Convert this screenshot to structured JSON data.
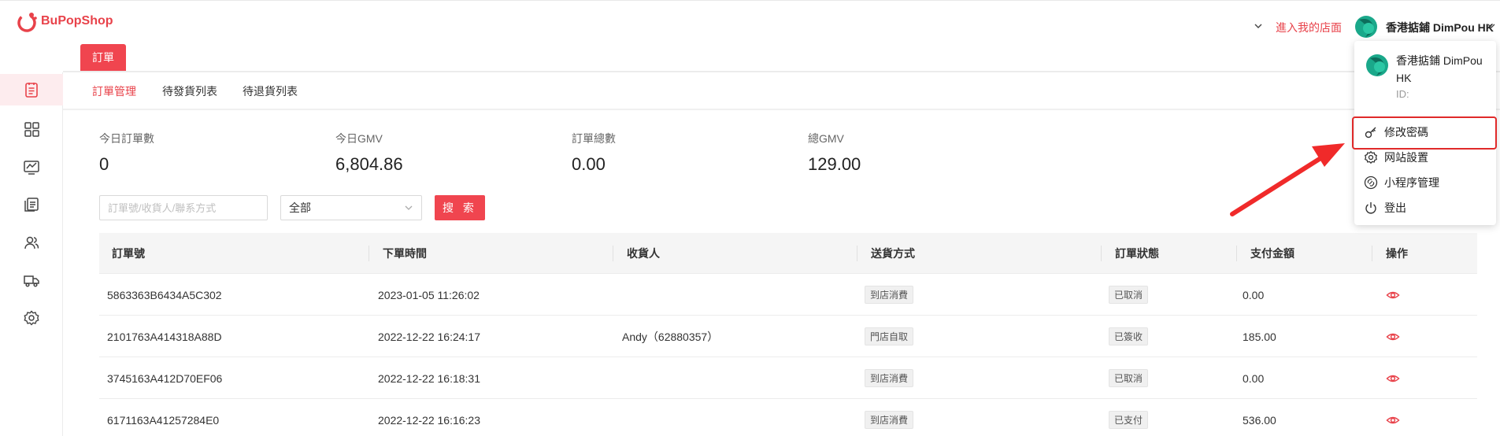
{
  "header": {
    "logo_text": "BuPopShop",
    "enter_store": "進入我的店面",
    "username": "香港掂鋪 DimPou HK",
    "accent_color": "#e8424a"
  },
  "top_tab": {
    "label": "訂單"
  },
  "sidebar": {
    "items": [
      {
        "icon": "order-list-icon",
        "active": true
      },
      {
        "icon": "grid-apps-icon",
        "active": false
      },
      {
        "icon": "chart-monitor-icon",
        "active": false
      },
      {
        "icon": "documents-icon",
        "active": false
      },
      {
        "icon": "users-icon",
        "active": false
      },
      {
        "icon": "delivery-truck-icon",
        "active": false
      },
      {
        "icon": "gear-icon",
        "active": false
      }
    ]
  },
  "subtabs": [
    {
      "label": "訂單管理",
      "active": true
    },
    {
      "label": "待發貨列表",
      "active": false
    },
    {
      "label": "待退貨列表",
      "active": false
    }
  ],
  "stats": [
    {
      "label": "今日訂單數",
      "value": "0"
    },
    {
      "label": "今日GMV",
      "value": "6,804.86"
    },
    {
      "label": "訂單總數",
      "value": "0.00"
    },
    {
      "label": "總GMV",
      "value": "129.00"
    }
  ],
  "filters": {
    "search_placeholder": "訂單號/收貨人/聯系方式",
    "select_value": "全部",
    "search_button": "搜 索"
  },
  "table": {
    "columns": [
      "訂單號",
      "下單時間",
      "收貨人",
      "送貨方式",
      "訂單狀態",
      "支付金額",
      "操作"
    ],
    "rows": [
      {
        "order_no": "5863363B6434A5C302",
        "time": "2023-01-05 11:26:02",
        "receiver": "",
        "delivery": "到店消費",
        "status": "已取消",
        "amount": "0.00"
      },
      {
        "order_no": "2101763A414318A88D",
        "time": "2022-12-22 16:24:17",
        "receiver": "Andy（62880357）",
        "delivery": "門店自取",
        "status": "已簽收",
        "amount": "185.00"
      },
      {
        "order_no": "3745163A412D70EF06",
        "time": "2022-12-22 16:18:31",
        "receiver": "",
        "delivery": "到店消費",
        "status": "已取消",
        "amount": "0.00"
      },
      {
        "order_no": "6171163A41257284E0",
        "time": "2022-12-22 16:16:23",
        "receiver": "",
        "delivery": "到店消費",
        "status": "已支付",
        "amount": "536.00"
      }
    ]
  },
  "dropdown": {
    "name": "香港掂鋪 DimPou HK",
    "id_label": "ID:",
    "items": [
      {
        "label": "修改密碼",
        "icon": "key-icon"
      },
      {
        "label": "网站設置",
        "icon": "gear-icon"
      },
      {
        "label": "小程序管理",
        "icon": "link-icon"
      },
      {
        "label": "登出",
        "icon": "power-icon"
      }
    ]
  }
}
